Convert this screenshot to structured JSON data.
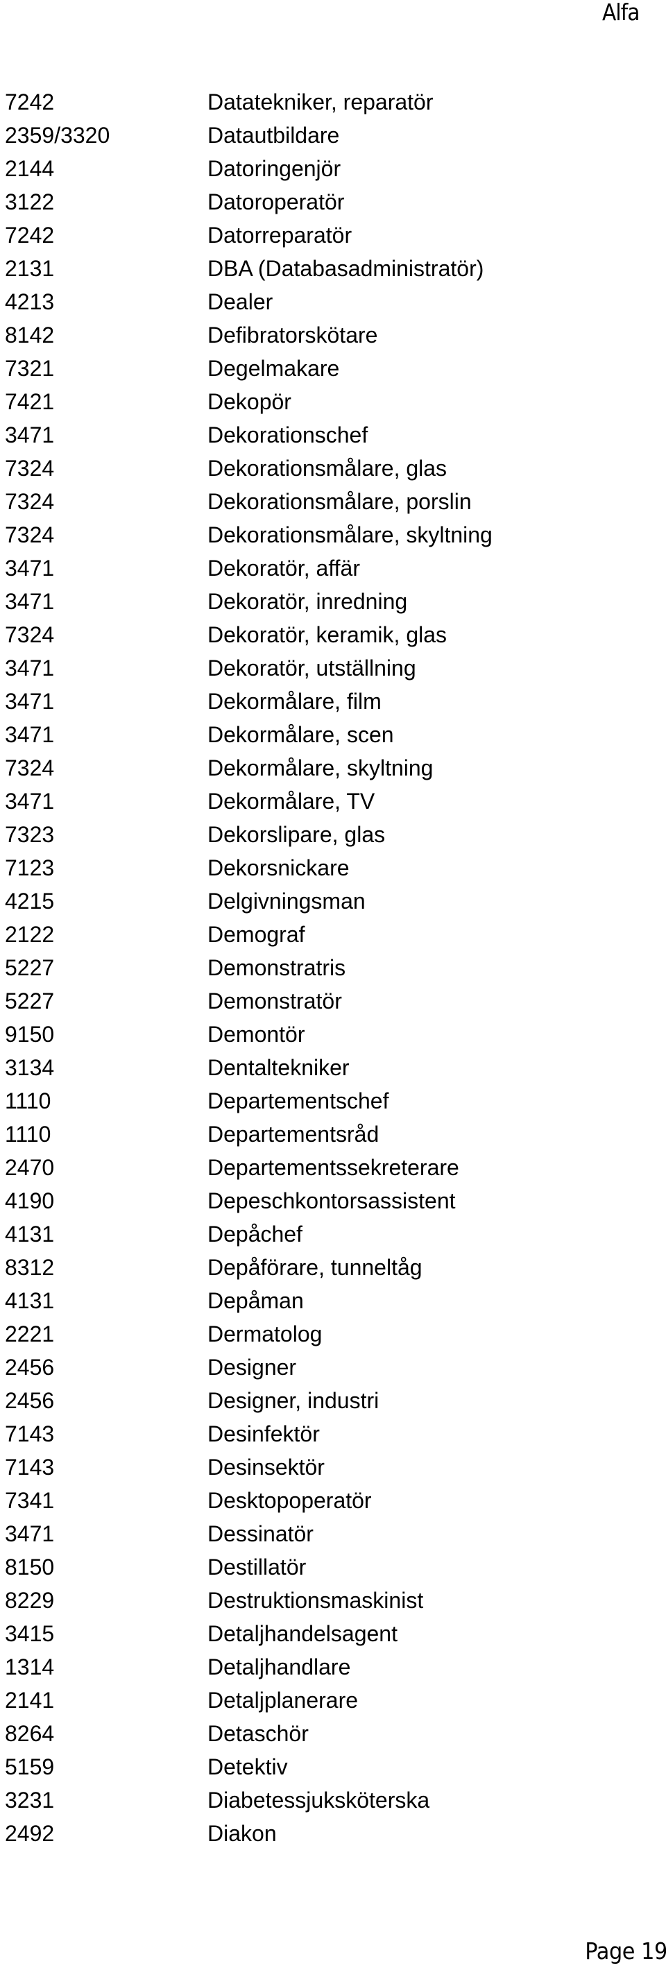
{
  "header": {
    "title": "Alfa"
  },
  "footer": {
    "page_label": "Page 19"
  },
  "entries": [
    {
      "code": "7242",
      "title": "Datatekniker, reparatör"
    },
    {
      "code": "2359/3320",
      "title": "Datautbildare"
    },
    {
      "code": "2144",
      "title": "Datoringenjör"
    },
    {
      "code": "3122",
      "title": "Datoroperatör"
    },
    {
      "code": "7242",
      "title": "Datorreparatör"
    },
    {
      "code": "2131",
      "title": "DBA (Databasadministratör)"
    },
    {
      "code": "4213",
      "title": "Dealer"
    },
    {
      "code": "8142",
      "title": "Defibratorskötare"
    },
    {
      "code": "7321",
      "title": "Degelmakare"
    },
    {
      "code": "7421",
      "title": "Dekopör"
    },
    {
      "code": "3471",
      "title": "Dekorationschef"
    },
    {
      "code": "7324",
      "title": "Dekorationsmålare, glas"
    },
    {
      "code": "7324",
      "title": "Dekorationsmålare, porslin"
    },
    {
      "code": "7324",
      "title": "Dekorationsmålare, skyltning"
    },
    {
      "code": "3471",
      "title": "Dekoratör, affär"
    },
    {
      "code": "3471",
      "title": "Dekoratör, inredning"
    },
    {
      "code": "7324",
      "title": "Dekoratör, keramik, glas"
    },
    {
      "code": "3471",
      "title": "Dekoratör, utställning"
    },
    {
      "code": "3471",
      "title": "Dekormålare, film"
    },
    {
      "code": "3471",
      "title": "Dekormålare, scen"
    },
    {
      "code": "7324",
      "title": "Dekormålare, skyltning"
    },
    {
      "code": "3471",
      "title": "Dekormålare, TV"
    },
    {
      "code": "7323",
      "title": "Dekorslipare, glas"
    },
    {
      "code": "7123",
      "title": "Dekorsnickare"
    },
    {
      "code": "4215",
      "title": "Delgivningsman"
    },
    {
      "code": "2122",
      "title": "Demograf"
    },
    {
      "code": "5227",
      "title": "Demonstratris"
    },
    {
      "code": "5227",
      "title": "Demonstratör"
    },
    {
      "code": "9150",
      "title": "Demontör"
    },
    {
      "code": "3134",
      "title": "Dentaltekniker"
    },
    {
      "code": "1110",
      "title": "Departementschef"
    },
    {
      "code": "1110",
      "title": "Departementsråd"
    },
    {
      "code": "2470",
      "title": "Departementssekreterare"
    },
    {
      "code": "4190",
      "title": "Depeschkontorsassistent"
    },
    {
      "code": "4131",
      "title": "Depåchef"
    },
    {
      "code": "8312",
      "title": "Depåförare, tunneltåg"
    },
    {
      "code": "4131",
      "title": "Depåman"
    },
    {
      "code": "2221",
      "title": "Dermatolog"
    },
    {
      "code": "2456",
      "title": "Designer"
    },
    {
      "code": "2456",
      "title": "Designer, industri"
    },
    {
      "code": "7143",
      "title": "Desinfektör"
    },
    {
      "code": "7143",
      "title": "Desinsektör"
    },
    {
      "code": "7341",
      "title": "Desktopoperatör"
    },
    {
      "code": "3471",
      "title": "Dessinatör"
    },
    {
      "code": "8150",
      "title": "Destillatör"
    },
    {
      "code": "8229",
      "title": "Destruktionsmaskinist"
    },
    {
      "code": "3415",
      "title": "Detaljhandelsagent"
    },
    {
      "code": "1314",
      "title": "Detaljhandlare"
    },
    {
      "code": "2141",
      "title": "Detaljplanerare"
    },
    {
      "code": "8264",
      "title": "Detaschör"
    },
    {
      "code": "5159",
      "title": "Detektiv"
    },
    {
      "code": "3231",
      "title": "Diabetessjuksköterska"
    },
    {
      "code": "2492",
      "title": "Diakon"
    }
  ]
}
